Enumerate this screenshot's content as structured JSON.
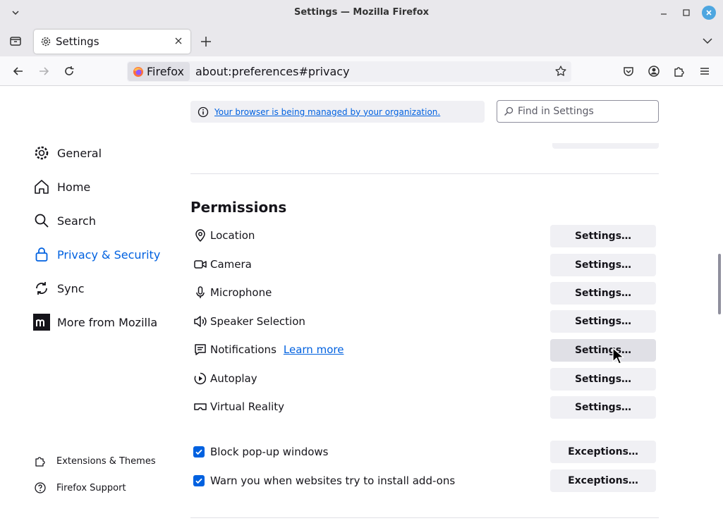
{
  "window": {
    "title": "Settings — Mozilla Firefox"
  },
  "tabs": [
    {
      "label": "Settings"
    }
  ],
  "urlbar": {
    "identity_label": "Firefox",
    "url": "about:preferences#privacy"
  },
  "banner": {
    "policy_text": "Your browser is being managed by your organization."
  },
  "search": {
    "placeholder": "Find in Settings"
  },
  "sidebar": {
    "items": [
      {
        "label": "General",
        "icon": "gear-icon"
      },
      {
        "label": "Home",
        "icon": "home-icon"
      },
      {
        "label": "Search",
        "icon": "search-icon"
      },
      {
        "label": "Privacy & Security",
        "icon": "lock-icon",
        "selected": true
      },
      {
        "label": "Sync",
        "icon": "sync-icon"
      },
      {
        "label": "More from Mozilla",
        "icon": "mozilla-m-icon"
      }
    ],
    "footer": [
      {
        "label": "Extensions & Themes",
        "icon": "puzzle-icon"
      },
      {
        "label": "Firefox Support",
        "icon": "help-icon"
      }
    ]
  },
  "permissions": {
    "heading": "Permissions",
    "rows": [
      {
        "label": "Location",
        "icon": "location-icon",
        "button": "Settings…"
      },
      {
        "label": "Camera",
        "icon": "camera-icon",
        "button": "Settings…"
      },
      {
        "label": "Microphone",
        "icon": "microphone-icon",
        "button": "Settings…"
      },
      {
        "label": "Speaker Selection",
        "icon": "speaker-icon",
        "button": "Settings…"
      },
      {
        "label": "Notifications",
        "icon": "notification-icon",
        "button": "Settings…",
        "link": "Learn more"
      },
      {
        "label": "Autoplay",
        "icon": "autoplay-icon",
        "button": "Settings…"
      },
      {
        "label": "Virtual Reality",
        "icon": "vr-icon",
        "button": "Settings…"
      }
    ],
    "checkboxes": [
      {
        "label": "Block pop-up windows",
        "checked": true,
        "button": "Exceptions…"
      },
      {
        "label": "Warn you when websites try to install add-ons",
        "checked": true,
        "button": "Exceptions…"
      }
    ]
  },
  "colors": {
    "accent": "#0061e0",
    "button_bg": "#f0f0f4",
    "titlebar_bg": "#e9e8ec",
    "close_button": "#4da6e0"
  }
}
